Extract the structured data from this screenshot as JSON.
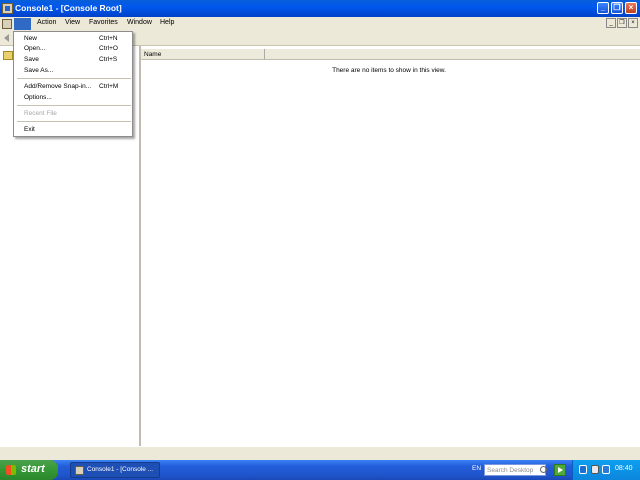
{
  "window": {
    "title": "Console1 - [Console Root]"
  },
  "menubar": {
    "items": [
      "File",
      "Action",
      "View",
      "Favorites",
      "Window",
      "Help"
    ]
  },
  "file_menu": {
    "items": [
      {
        "label": "New",
        "shortcut": "Ctrl+N"
      },
      {
        "label": "Open...",
        "shortcut": "Ctrl+O"
      },
      {
        "label": "Save",
        "shortcut": "Ctrl+S"
      },
      {
        "label": "Save As...",
        "shortcut": ""
      },
      {
        "label": "Add/Remove Snap-in...",
        "shortcut": "Ctrl+M"
      },
      {
        "label": "Options...",
        "shortcut": ""
      },
      {
        "label": "Recent File",
        "shortcut": ""
      },
      {
        "label": "Exit",
        "shortcut": ""
      }
    ]
  },
  "list": {
    "column_name": "Name",
    "empty_message": "There are no items to show in this view."
  },
  "taskbar": {
    "start_label": "start",
    "task_label": "Console1 - [Console ...",
    "language": "EN",
    "search_placeholder": "Search Desktop",
    "clock": "08:40"
  }
}
